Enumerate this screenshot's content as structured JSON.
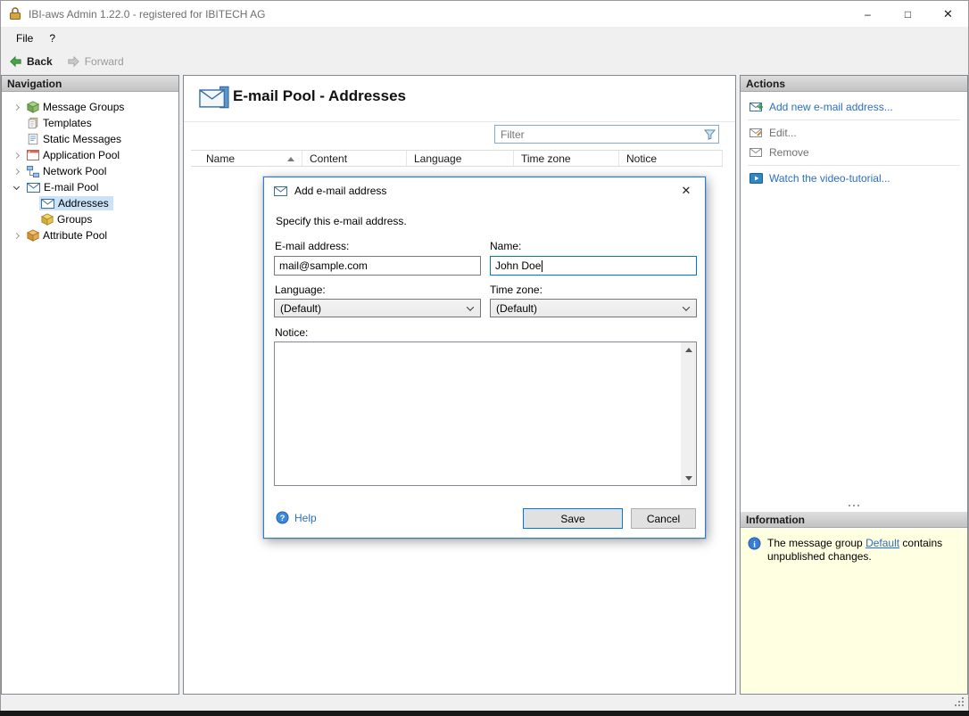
{
  "window": {
    "title": "IBI-aws Admin 1.22.0 - registered for IBITECH AG",
    "controls": {
      "minimize": "–",
      "maximize": "□",
      "close": "✕"
    }
  },
  "menu": {
    "file": "File",
    "help": "?"
  },
  "toolbar": {
    "back": "Back",
    "forward": "Forward"
  },
  "navigation": {
    "header": "Navigation",
    "items": [
      {
        "label": "Message Groups"
      },
      {
        "label": "Templates"
      },
      {
        "label": "Static Messages"
      },
      {
        "label": "Application Pool"
      },
      {
        "label": "Network Pool"
      },
      {
        "label": "E-mail Pool"
      },
      {
        "label": "Addresses"
      },
      {
        "label": "Groups"
      },
      {
        "label": "Attribute Pool"
      }
    ]
  },
  "main": {
    "title": "E-mail Pool - Addresses",
    "filter_placeholder": "Filter",
    "table": {
      "columns": [
        "Name",
        "Content",
        "Language",
        "Time zone",
        "Notice"
      ],
      "rows": []
    }
  },
  "dialog": {
    "title": "Add e-mail address",
    "close": "✕",
    "description": "Specify this e-mail address.",
    "email_label": "E-mail address:",
    "email_value": "mail@sample.com",
    "name_label": "Name:",
    "name_value": "John Doe",
    "language_label": "Language:",
    "language_value": "(Default)",
    "timezone_label": "Time zone:",
    "timezone_value": "(Default)",
    "notice_label": "Notice:",
    "notice_value": "",
    "help_label": "Help",
    "save_label": "Save",
    "cancel_label": "Cancel"
  },
  "actions": {
    "header": "Actions",
    "items": [
      {
        "label": "Add new e-mail address...",
        "enabled": true
      },
      {
        "label": "Edit...",
        "enabled": false
      },
      {
        "label": "Remove",
        "enabled": false
      },
      {
        "label": "Watch the video-tutorial...",
        "enabled": true
      }
    ]
  },
  "information": {
    "header": "Information",
    "text_before": "The message group ",
    "link_text": "Default",
    "text_after": " contains unpublished changes."
  },
  "colors": {
    "accent": "#2b6fbf",
    "selection": "#cbe3f6",
    "info_bg": "#ffffe1",
    "dialog_border": "#2b7cd3"
  }
}
